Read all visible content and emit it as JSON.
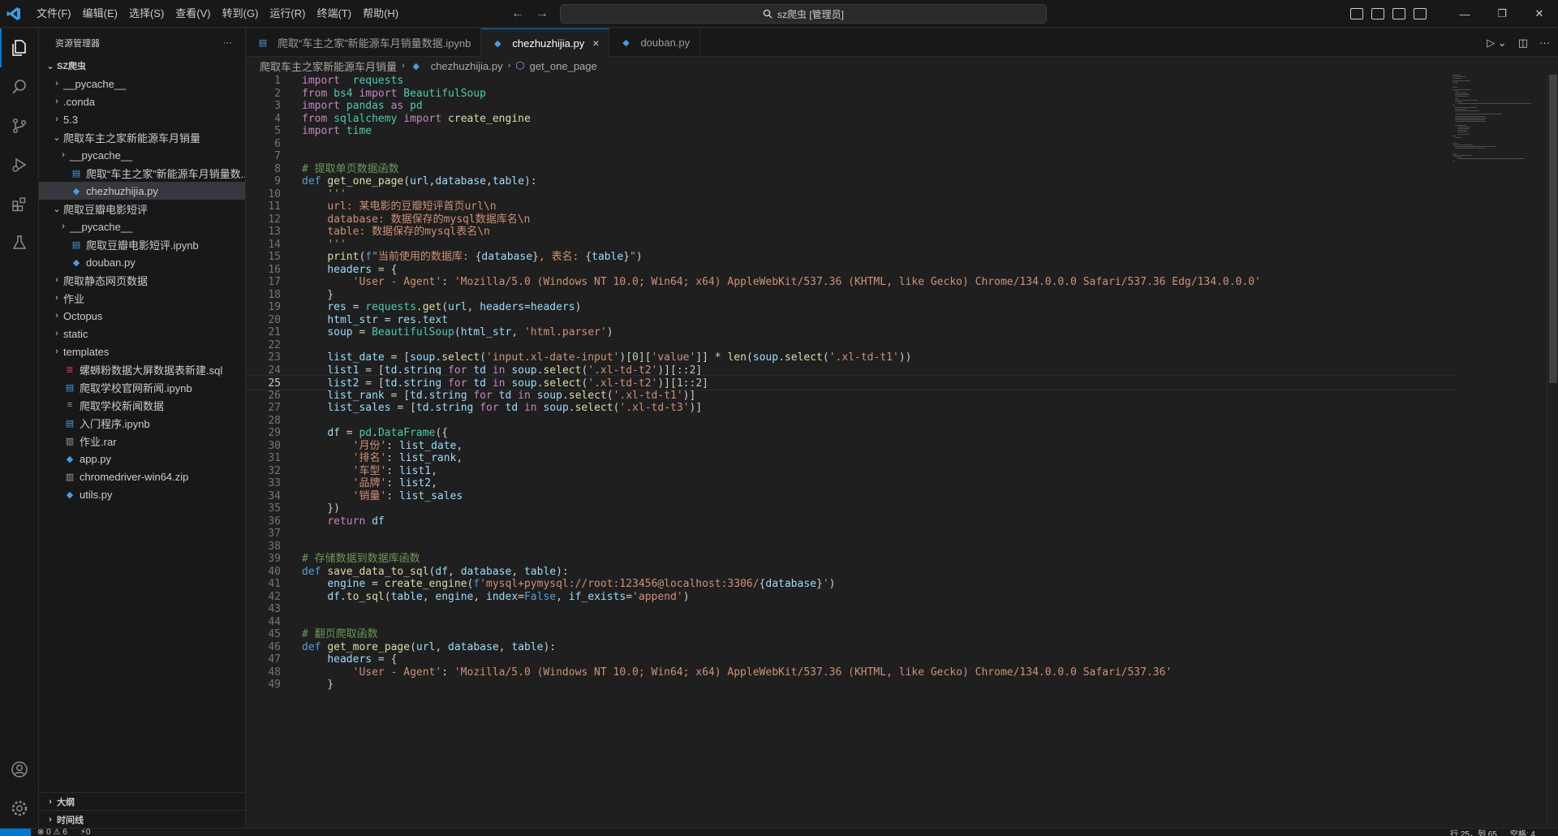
{
  "menu": [
    "文件(F)",
    "编辑(E)",
    "选择(S)",
    "查看(V)",
    "转到(G)",
    "运行(R)",
    "终端(T)",
    "帮助(H)"
  ],
  "search": {
    "text": "sz爬虫 [管理员]"
  },
  "sidebar": {
    "title": "资源管理器",
    "more": "···",
    "root": "SZ爬虫",
    "items": [
      {
        "label": "__pycache__",
        "depth": 1,
        "kind": "folder-closed"
      },
      {
        "label": ".conda",
        "depth": 1,
        "kind": "folder-closed"
      },
      {
        "label": "5.3",
        "depth": 1,
        "kind": "folder-closed"
      },
      {
        "label": "爬取车主之家新能源车月销量",
        "depth": 1,
        "kind": "folder-open"
      },
      {
        "label": "__pycache__",
        "depth": 2,
        "kind": "folder-closed"
      },
      {
        "label": "爬取“车主之家”新能源车月销量数...",
        "depth": 2,
        "kind": "nb"
      },
      {
        "label": "chezhuzhijia.py",
        "depth": 2,
        "kind": "py",
        "selected": true
      },
      {
        "label": "爬取豆瓣电影短评",
        "depth": 1,
        "kind": "folder-open"
      },
      {
        "label": "__pycache__",
        "depth": 2,
        "kind": "folder-closed"
      },
      {
        "label": "爬取豆瓣电影短评.ipynb",
        "depth": 2,
        "kind": "nb"
      },
      {
        "label": "douban.py",
        "depth": 2,
        "kind": "py"
      },
      {
        "label": "爬取静态网页数据",
        "depth": 1,
        "kind": "folder-closed"
      },
      {
        "label": "作业",
        "depth": 1,
        "kind": "folder-closed"
      },
      {
        "label": "Octopus",
        "depth": 1,
        "kind": "folder-closed"
      },
      {
        "label": "static",
        "depth": 1,
        "kind": "folder-closed"
      },
      {
        "label": "templates",
        "depth": 1,
        "kind": "folder-closed"
      },
      {
        "label": "螺蛳粉数据大屏数据表新建.sql",
        "depth": 1,
        "kind": "sql"
      },
      {
        "label": "爬取学校官网新闻.ipynb",
        "depth": 1,
        "kind": "nb"
      },
      {
        "label": "爬取学校新闻数据",
        "depth": 1,
        "kind": "txt"
      },
      {
        "label": "入门程序.ipynb",
        "depth": 1,
        "kind": "nb"
      },
      {
        "label": "作业.rar",
        "depth": 1,
        "kind": "zip"
      },
      {
        "label": "app.py",
        "depth": 1,
        "kind": "py"
      },
      {
        "label": "chromedriver-win64.zip",
        "depth": 1,
        "kind": "zip"
      },
      {
        "label": "utils.py",
        "depth": 1,
        "kind": "py"
      }
    ],
    "footer": [
      "大纲",
      "时间线"
    ]
  },
  "tabs": [
    {
      "label": "爬取“车主之家”新能源车月销量数据.ipynb",
      "active": false
    },
    {
      "label": "chezhuzhijia.py",
      "active": true,
      "close": "×"
    },
    {
      "label": "douban.py",
      "active": false
    }
  ],
  "breadcrumb": [
    "爬取车主之家新能源车月销量",
    "chezhuzhijia.py",
    "get_one_page"
  ],
  "current_line": 25,
  "code": [
    [
      [
        "kw",
        "import"
      ],
      [
        "",
        "  "
      ],
      [
        "mod",
        "requests"
      ]
    ],
    [
      [
        "kw",
        "from"
      ],
      [
        "",
        " "
      ],
      [
        "mod",
        "bs4"
      ],
      [
        "",
        " "
      ],
      [
        "kw",
        "import"
      ],
      [
        "",
        " "
      ],
      [
        "cls",
        "BeautifulSoup"
      ]
    ],
    [
      [
        "kw",
        "import"
      ],
      [
        "",
        " "
      ],
      [
        "mod",
        "pandas"
      ],
      [
        "",
        " "
      ],
      [
        "kw",
        "as"
      ],
      [
        "",
        " "
      ],
      [
        "mod",
        "pd"
      ]
    ],
    [
      [
        "kw",
        "from"
      ],
      [
        "",
        " "
      ],
      [
        "mod",
        "sqlalchemy"
      ],
      [
        "",
        " "
      ],
      [
        "kw",
        "import"
      ],
      [
        "",
        " "
      ],
      [
        "fn",
        "create_engine"
      ]
    ],
    [
      [
        "kw",
        "import"
      ],
      [
        "",
        " "
      ],
      [
        "mod",
        "time"
      ]
    ],
    [],
    [],
    [
      [
        "cmt",
        "# 提取单页数据函数"
      ]
    ],
    [
      [
        "kw2",
        "def"
      ],
      [
        "",
        " "
      ],
      [
        "fn",
        "get_one_page"
      ],
      [
        "",
        "("
      ],
      [
        "var",
        "url"
      ],
      [
        "",
        ","
      ],
      [
        "var",
        "database"
      ],
      [
        "",
        ","
      ],
      [
        "var",
        "table"
      ],
      [
        "",
        "):"
      ]
    ],
    [
      [
        "",
        "    "
      ],
      [
        "str",
        "'''"
      ]
    ],
    [
      [
        "",
        "    "
      ],
      [
        "str",
        "url: 某电影的豆瓣短评首页url\\n"
      ]
    ],
    [
      [
        "",
        "    "
      ],
      [
        "str",
        "database: 数据保存的mysql数据库名\\n"
      ]
    ],
    [
      [
        "",
        "    "
      ],
      [
        "str",
        "table: 数据保存的mysql表名\\n"
      ]
    ],
    [
      [
        "",
        "    "
      ],
      [
        "str",
        "'''"
      ]
    ],
    [
      [
        "",
        "    "
      ],
      [
        "fn",
        "print"
      ],
      [
        "",
        "("
      ],
      [
        "kw2",
        "f"
      ],
      [
        "str",
        "\"当前使用的数据库: "
      ],
      [
        "",
        "{"
      ],
      [
        "var",
        "database"
      ],
      [
        "",
        "}"
      ],
      [
        "str",
        ", 表名: "
      ],
      [
        "",
        "{"
      ],
      [
        "var",
        "table"
      ],
      [
        "",
        "}"
      ],
      [
        "str",
        "\""
      ],
      [
        "",
        ")"
      ]
    ],
    [
      [
        "",
        "    "
      ],
      [
        "var",
        "headers"
      ],
      [
        "",
        " = {"
      ]
    ],
    [
      [
        "",
        "        "
      ],
      [
        "str",
        "'User - Agent'"
      ],
      [
        "",
        ": "
      ],
      [
        "str",
        "'Mozilla/5.0 (Windows NT 10.0; Win64; x64) AppleWebKit/537.36 (KHTML, like Gecko) Chrome/134.0.0.0 Safari/537.36 Edg/134.0.0.0'"
      ]
    ],
    [
      [
        "",
        "    }"
      ]
    ],
    [
      [
        "",
        "    "
      ],
      [
        "var",
        "res"
      ],
      [
        "",
        " = "
      ],
      [
        "mod",
        "requests"
      ],
      [
        "",
        "."
      ],
      [
        "fn",
        "get"
      ],
      [
        "",
        "("
      ],
      [
        "var",
        "url"
      ],
      [
        "",
        ", "
      ],
      [
        "var",
        "headers"
      ],
      [
        "",
        "="
      ],
      [
        "var",
        "headers"
      ],
      [
        "",
        ")"
      ]
    ],
    [
      [
        "",
        "    "
      ],
      [
        "var",
        "html_str"
      ],
      [
        "",
        " = "
      ],
      [
        "var",
        "res"
      ],
      [
        "",
        "."
      ],
      [
        "var",
        "text"
      ]
    ],
    [
      [
        "",
        "    "
      ],
      [
        "var",
        "soup"
      ],
      [
        "",
        " = "
      ],
      [
        "cls",
        "BeautifulSoup"
      ],
      [
        "",
        "("
      ],
      [
        "var",
        "html_str"
      ],
      [
        "",
        ", "
      ],
      [
        "str",
        "'html.parser'"
      ],
      [
        "",
        ")"
      ]
    ],
    [],
    [
      [
        "",
        "    "
      ],
      [
        "var",
        "list_date"
      ],
      [
        "",
        " = ["
      ],
      [
        "var",
        "soup"
      ],
      [
        "",
        "."
      ],
      [
        "fn",
        "select"
      ],
      [
        "",
        "("
      ],
      [
        "str",
        "'input.xl-date-input'"
      ],
      [
        "",
        ")["
      ],
      [
        "num",
        "0"
      ],
      [
        "",
        "]["
      ],
      [
        "str",
        "'value'"
      ],
      [
        "",
        "]] * "
      ],
      [
        "fn",
        "len"
      ],
      [
        "",
        "("
      ],
      [
        "var",
        "soup"
      ],
      [
        "",
        "."
      ],
      [
        "fn",
        "select"
      ],
      [
        "",
        "("
      ],
      [
        "str",
        "'.xl-td-t1'"
      ],
      [
        "",
        "))"
      ]
    ],
    [
      [
        "",
        "    "
      ],
      [
        "var",
        "list1"
      ],
      [
        "",
        " = ["
      ],
      [
        "var",
        "td"
      ],
      [
        "",
        "."
      ],
      [
        "var",
        "string"
      ],
      [
        "",
        " "
      ],
      [
        "kw",
        "for"
      ],
      [
        "",
        " "
      ],
      [
        "var",
        "td"
      ],
      [
        "",
        " "
      ],
      [
        "kw",
        "in"
      ],
      [
        "",
        " "
      ],
      [
        "var",
        "soup"
      ],
      [
        "",
        "."
      ],
      [
        "fn",
        "select"
      ],
      [
        "",
        "("
      ],
      [
        "str",
        "'.xl-td-t2'"
      ],
      [
        "",
        ")][::"
      ],
      [
        "num",
        "2"
      ],
      [
        "",
        "]"
      ]
    ],
    [
      [
        "",
        "    "
      ],
      [
        "var",
        "list2"
      ],
      [
        "",
        " = ["
      ],
      [
        "var",
        "td"
      ],
      [
        "",
        "."
      ],
      [
        "var",
        "string"
      ],
      [
        "",
        " "
      ],
      [
        "kw",
        "for"
      ],
      [
        "",
        " "
      ],
      [
        "var",
        "td"
      ],
      [
        "",
        " "
      ],
      [
        "kw",
        "in"
      ],
      [
        "",
        " "
      ],
      [
        "var",
        "soup"
      ],
      [
        "",
        "."
      ],
      [
        "fn",
        "select"
      ],
      [
        "",
        "("
      ],
      [
        "str",
        "'.xl-td-t2'"
      ],
      [
        "",
        ")]["
      ],
      [
        "num",
        "1"
      ],
      [
        "",
        "::"
      ],
      [
        "num",
        "2"
      ],
      [
        "",
        "]"
      ]
    ],
    [
      [
        "",
        "    "
      ],
      [
        "var",
        "list_rank"
      ],
      [
        "",
        " = ["
      ],
      [
        "var",
        "td"
      ],
      [
        "",
        "."
      ],
      [
        "var",
        "string"
      ],
      [
        "",
        " "
      ],
      [
        "kw",
        "for"
      ],
      [
        "",
        " "
      ],
      [
        "var",
        "td"
      ],
      [
        "",
        " "
      ],
      [
        "kw",
        "in"
      ],
      [
        "",
        " "
      ],
      [
        "var",
        "soup"
      ],
      [
        "",
        "."
      ],
      [
        "fn",
        "select"
      ],
      [
        "",
        "("
      ],
      [
        "str",
        "'.xl-td-t1'"
      ],
      [
        "",
        ")]"
      ]
    ],
    [
      [
        "",
        "    "
      ],
      [
        "var",
        "list_sales"
      ],
      [
        "",
        " = ["
      ],
      [
        "var",
        "td"
      ],
      [
        "",
        "."
      ],
      [
        "var",
        "string"
      ],
      [
        "",
        " "
      ],
      [
        "kw",
        "for"
      ],
      [
        "",
        " "
      ],
      [
        "var",
        "td"
      ],
      [
        "",
        " "
      ],
      [
        "kw",
        "in"
      ],
      [
        "",
        " "
      ],
      [
        "var",
        "soup"
      ],
      [
        "",
        "."
      ],
      [
        "fn",
        "select"
      ],
      [
        "",
        "("
      ],
      [
        "str",
        "'.xl-td-t3'"
      ],
      [
        "",
        ")]"
      ]
    ],
    [],
    [
      [
        "",
        "    "
      ],
      [
        "var",
        "df"
      ],
      [
        "",
        " = "
      ],
      [
        "mod",
        "pd"
      ],
      [
        "",
        "."
      ],
      [
        "cls",
        "DataFrame"
      ],
      [
        "",
        "({"
      ]
    ],
    [
      [
        "",
        "        "
      ],
      [
        "str",
        "'月份'"
      ],
      [
        "",
        ": "
      ],
      [
        "var",
        "list_date"
      ],
      [
        "",
        ","
      ]
    ],
    [
      [
        "",
        "        "
      ],
      [
        "str",
        "'排名'"
      ],
      [
        "",
        ": "
      ],
      [
        "var",
        "list_rank"
      ],
      [
        "",
        ","
      ]
    ],
    [
      [
        "",
        "        "
      ],
      [
        "str",
        "'车型'"
      ],
      [
        "",
        ": "
      ],
      [
        "var",
        "list1"
      ],
      [
        "",
        ","
      ]
    ],
    [
      [
        "",
        "        "
      ],
      [
        "str",
        "'品牌'"
      ],
      [
        "",
        ": "
      ],
      [
        "var",
        "list2"
      ],
      [
        "",
        ","
      ]
    ],
    [
      [
        "",
        "        "
      ],
      [
        "str",
        "'销量'"
      ],
      [
        "",
        ": "
      ],
      [
        "var",
        "list_sales"
      ]
    ],
    [
      [
        "",
        "    })"
      ]
    ],
    [
      [
        "",
        "    "
      ],
      [
        "kw",
        "return"
      ],
      [
        "",
        " "
      ],
      [
        "var",
        "df"
      ]
    ],
    [],
    [],
    [
      [
        "cmt",
        "# 存储数据到数据库函数"
      ]
    ],
    [
      [
        "kw2",
        "def"
      ],
      [
        "",
        " "
      ],
      [
        "fn",
        "save_data_to_sql"
      ],
      [
        "",
        "("
      ],
      [
        "var",
        "df"
      ],
      [
        "",
        ", "
      ],
      [
        "var",
        "database"
      ],
      [
        "",
        ", "
      ],
      [
        "var",
        "table"
      ],
      [
        "",
        "):"
      ]
    ],
    [
      [
        "",
        "    "
      ],
      [
        "var",
        "engine"
      ],
      [
        "",
        " = "
      ],
      [
        "fn",
        "create_engine"
      ],
      [
        "",
        "("
      ],
      [
        "kw2",
        "f"
      ],
      [
        "str",
        "'mysql+pymysql://root:123456@localhost:3306/"
      ],
      [
        "",
        "{"
      ],
      [
        "var",
        "database"
      ],
      [
        "",
        "}"
      ],
      [
        "str",
        "'"
      ],
      [
        "",
        ")"
      ]
    ],
    [
      [
        "",
        "    "
      ],
      [
        "var",
        "df"
      ],
      [
        "",
        "."
      ],
      [
        "fn",
        "to_sql"
      ],
      [
        "",
        "("
      ],
      [
        "var",
        "table"
      ],
      [
        "",
        ", "
      ],
      [
        "var",
        "engine"
      ],
      [
        "",
        ", "
      ],
      [
        "var",
        "index"
      ],
      [
        "",
        "="
      ],
      [
        "kw2",
        "False"
      ],
      [
        "",
        ", "
      ],
      [
        "var",
        "if_exists"
      ],
      [
        "",
        "="
      ],
      [
        "str",
        "'append'"
      ],
      [
        "",
        ")"
      ]
    ],
    [],
    [],
    [
      [
        "cmt",
        "# 翻页爬取函数"
      ]
    ],
    [
      [
        "kw2",
        "def"
      ],
      [
        "",
        " "
      ],
      [
        "fn",
        "get_more_page"
      ],
      [
        "",
        "("
      ],
      [
        "var",
        "url"
      ],
      [
        "",
        ", "
      ],
      [
        "var",
        "database"
      ],
      [
        "",
        ", "
      ],
      [
        "var",
        "table"
      ],
      [
        "",
        "):"
      ]
    ],
    [
      [
        "",
        "    "
      ],
      [
        "var",
        "headers"
      ],
      [
        "",
        " = {"
      ]
    ],
    [
      [
        "",
        "        "
      ],
      [
        "str",
        "'User - Agent'"
      ],
      [
        "",
        ": "
      ],
      [
        "str",
        "'Mozilla/5.0 (Windows NT 10.0; Win64; x64) AppleWebKit/537.36 (KHTML, like Gecko) Chrome/134.0.0.0 Safari/537.36'"
      ]
    ],
    [
      [
        "",
        "    }"
      ]
    ]
  ],
  "status": {
    "left": [
      "⊗ 0 ⚠ 6",
      "⚡0"
    ],
    "right": [
      "行 25，列 65",
      "空格: 4"
    ]
  }
}
